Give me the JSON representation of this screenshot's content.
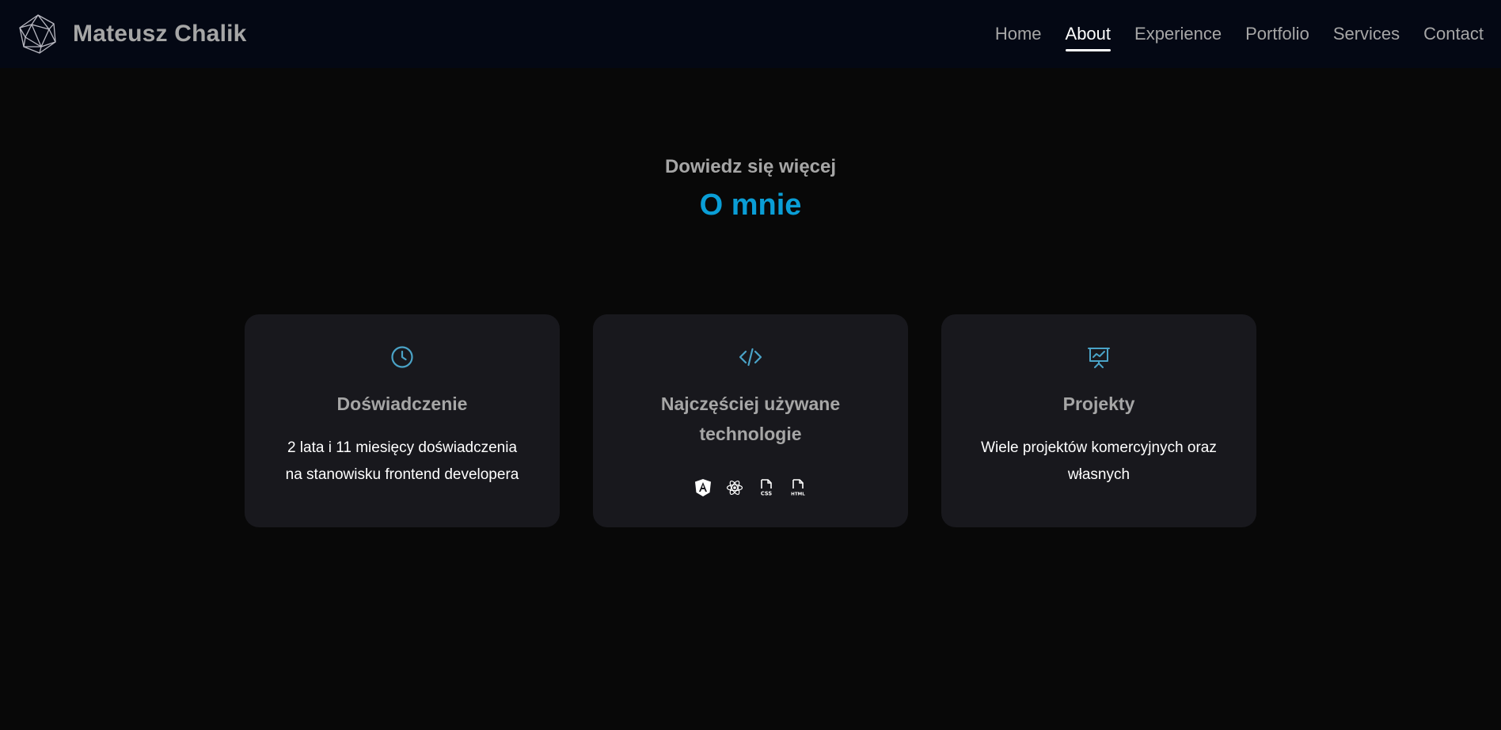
{
  "header": {
    "brand_name": "Mateusz Chalik",
    "logo_icon": "polyhedron-logo-icon",
    "nav": [
      {
        "label": "Home",
        "active": false
      },
      {
        "label": "About",
        "active": true
      },
      {
        "label": "Experience",
        "active": false
      },
      {
        "label": "Portfolio",
        "active": false
      },
      {
        "label": "Services",
        "active": false
      },
      {
        "label": "Contact",
        "active": false
      }
    ]
  },
  "section": {
    "subtitle": "Dowiedz się więcej",
    "title": "O mnie"
  },
  "cards": [
    {
      "icon": "clock-icon",
      "title": "Doświadczenie",
      "text_line1": "2 lata i 11 miesięcy doświadczenia",
      "text_line2": "na stanowisku frontend developera"
    },
    {
      "icon": "code-icon",
      "title": "Najczęściej używane technologie",
      "tech_icons": [
        "angular-icon",
        "react-icon",
        "css-file-icon",
        "html-file-icon"
      ],
      "css_badge": "CSS",
      "html_badge": "HTML"
    },
    {
      "icon": "presentation-chart-icon",
      "title": "Projekty",
      "text_line1": "Wiele projektów komercyjnych oraz",
      "text_line2": "własnych"
    }
  ],
  "colors": {
    "background": "#080808",
    "navbar": "#040814",
    "card": "#18181d",
    "accent": "#0a9ed6",
    "icon": "#4aa3c7",
    "muted_text": "#a6a6a6"
  }
}
